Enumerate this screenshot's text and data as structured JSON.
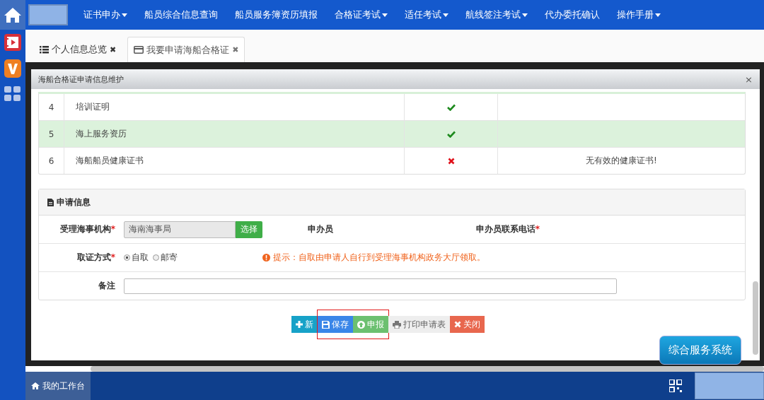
{
  "nav": {
    "items": [
      {
        "label": "证书申办",
        "dropdown": true
      },
      {
        "label": "船员综合信息查询",
        "dropdown": false
      },
      {
        "label": "船员服务簿资历填报",
        "dropdown": false
      },
      {
        "label": "合格证考试",
        "dropdown": true
      },
      {
        "label": "适任考试",
        "dropdown": true
      },
      {
        "label": "航线签注考试",
        "dropdown": true
      },
      {
        "label": "代办委托确认",
        "dropdown": false
      },
      {
        "label": "操作手册",
        "dropdown": true
      }
    ]
  },
  "tabs": [
    {
      "label": "个人信息总览",
      "close": "✖",
      "selected": false
    },
    {
      "label": "我要申请海船合格证",
      "close": "✖",
      "selected": true
    }
  ],
  "dialog": {
    "title": "海船合格证申请信息维护",
    "close": "×"
  },
  "requirements": {
    "rows": [
      {
        "index": "4",
        "name": "培训证明",
        "ok": true,
        "selected": false
      },
      {
        "index": "5",
        "name": "海上服务资历",
        "ok": true,
        "selected": true
      },
      {
        "index": "6",
        "name": "海船船员健康证书",
        "ok": false,
        "note": "无有效的健康证书!",
        "selected": false
      }
    ]
  },
  "application": {
    "title": "申请信息",
    "authority": {
      "label": "受理海事机构",
      "required_mark": "*",
      "value": "海南海事局",
      "button": "选择"
    },
    "applicant": {
      "label": "申办员"
    },
    "phone": {
      "label": "申办员联系电话",
      "required_mark": "*"
    },
    "delivery": {
      "label": "取证方式",
      "required_mark": "*",
      "options": [
        {
          "label": "自取",
          "selected": true
        },
        {
          "label": "邮寄",
          "selected": false
        }
      ],
      "hint": "提示：自取由申请人自行到受理海事机构政务大厅领取。"
    },
    "remark": {
      "label": "备注"
    }
  },
  "buttons": [
    {
      "label": "新",
      "kind": "add",
      "highlighted": false
    },
    {
      "label": "保存",
      "kind": "save",
      "highlighted": true
    },
    {
      "label": "申报",
      "kind": "submit",
      "highlighted": true
    },
    {
      "label": "打印申请表",
      "kind": "print",
      "highlighted": false
    },
    {
      "label": "关闭",
      "kind": "close",
      "highlighted": false
    }
  ],
  "floating_button": "综合服务系统",
  "taskbar": {
    "start": "我的工作台"
  }
}
